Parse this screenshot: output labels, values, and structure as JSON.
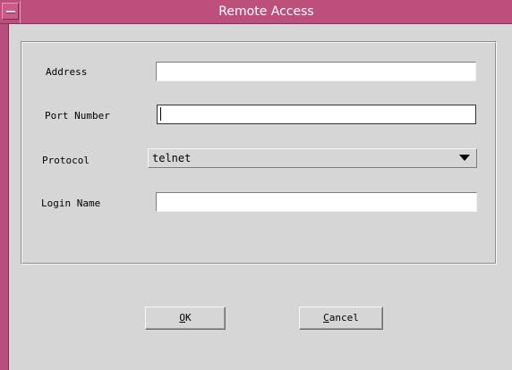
{
  "window": {
    "title": "Remote Access"
  },
  "form": {
    "address": {
      "label": "Address",
      "value": ""
    },
    "port": {
      "label": "Port Number",
      "value": ""
    },
    "protocol": {
      "label": "Protocol",
      "selected": "telnet"
    },
    "login": {
      "label": "Login Name",
      "value": ""
    }
  },
  "buttons": {
    "ok": {
      "mnemonic": "O",
      "rest": "K"
    },
    "cancel": {
      "mnemonic": "C",
      "rest": "ancel"
    }
  },
  "colors": {
    "titlebar": "#bd4f7d",
    "window_bg": "#d6d6d6"
  },
  "icons": {
    "window_menu": "window-menu-icon",
    "dropdown": "chevron-down-icon"
  }
}
